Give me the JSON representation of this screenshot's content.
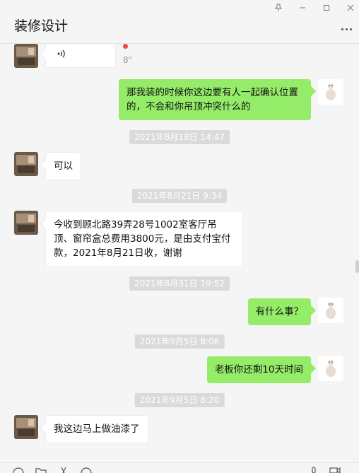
{
  "window": {
    "title": "装修设计",
    "controls": [
      "pin-icon",
      "minimize-icon",
      "maximize-icon",
      "close-icon"
    ]
  },
  "colors": {
    "background": "#f5f5f5",
    "self_bubble": "#95ec69",
    "other_bubble": "#ffffff",
    "timestamp_bg": "#dadada",
    "unread_dot": "#f04843"
  },
  "messages": [
    {
      "type": "voice",
      "side": "left",
      "duration": "8\"",
      "unread": true
    },
    {
      "type": "text",
      "side": "right",
      "text": "那我装的时候你这边要有人一起确认位置的，不会和你吊顶冲突什么的"
    },
    {
      "type": "time",
      "text": "2021年8月18日 14:47"
    },
    {
      "type": "text",
      "side": "left",
      "text": "可以"
    },
    {
      "type": "time",
      "text": "2021年8月21日 9:34"
    },
    {
      "type": "text",
      "side": "left",
      "text": "今收到顾北路39弄28号1002室客厅吊顶、窗帘盒总费用3800元，是由支付宝付款，2021年8月21日收，谢谢"
    },
    {
      "type": "time",
      "text": "2021年8月31日 19:52"
    },
    {
      "type": "text",
      "side": "right",
      "text": "有什么事？"
    },
    {
      "type": "time",
      "text": "2021年9月5日 8:06"
    },
    {
      "type": "text",
      "side": "right",
      "text": "老板你还剩10天时间"
    },
    {
      "type": "time",
      "text": "2021年9月5日 8:20"
    },
    {
      "type": "text",
      "side": "left",
      "text": "我这边马上做油漆了"
    }
  ],
  "toolbar": {
    "icons": [
      "emoji-icon",
      "folder-icon",
      "scissors-icon",
      "chat-bubble-icon",
      "microphone-icon",
      "video-call-icon"
    ]
  }
}
